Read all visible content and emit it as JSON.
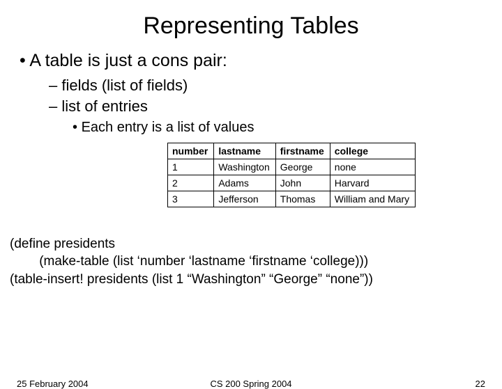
{
  "title": "Representing Tables",
  "bullets": {
    "l1": "A table is just a cons pair:",
    "l2a": "fields (list of fields)",
    "l2b": "list of entries",
    "l3": "Each entry is a list of values"
  },
  "chart_data": {
    "type": "table",
    "headers": [
      "number",
      "lastname",
      "firstname",
      "college"
    ],
    "rows": [
      [
        "1",
        "Washington",
        "George",
        "none"
      ],
      [
        "2",
        "Adams",
        "John",
        "Harvard"
      ],
      [
        "3",
        "Jefferson",
        "Thomas",
        "William and Mary"
      ]
    ]
  },
  "code": {
    "line1": "(define presidents",
    "line2": "        (make-table (list ‘number ‘lastname ‘firstname ‘college)))",
    "line3": "(table-insert! presidents (list 1 “Washington” “George” “none”))"
  },
  "footer": {
    "date": "25 February 2004",
    "course": "CS 200 Spring 2004",
    "page": "22"
  }
}
